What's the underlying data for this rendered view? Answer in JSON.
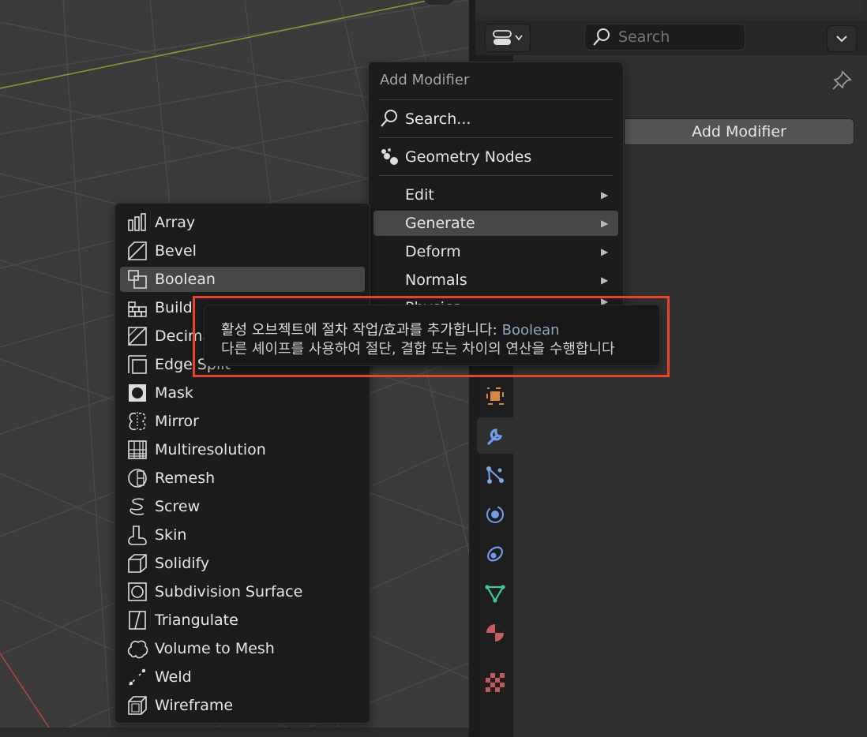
{
  "header": {
    "search_placeholder": "Search"
  },
  "properties": {
    "add_modifier_button": "Add Modifier"
  },
  "add_menu": {
    "title": "Add Modifier",
    "search": "Search...",
    "geometry_nodes": "Geometry Nodes",
    "categories": [
      "Edit",
      "Generate",
      "Deform",
      "Normals",
      "Physics"
    ],
    "highlighted": "Generate"
  },
  "generate_menu": {
    "items": [
      "Array",
      "Bevel",
      "Boolean",
      "Build",
      "Decimate",
      "Edge Split",
      "Mask",
      "Mirror",
      "Multiresolution",
      "Remesh",
      "Screw",
      "Skin",
      "Solidify",
      "Subdivision Surface",
      "Triangulate",
      "Volume to Mesh",
      "Weld",
      "Wireframe"
    ],
    "highlighted": "Boolean"
  },
  "tooltip": {
    "line1": "활성 오브젝트에 절차 작업/효과를 추가합니다:",
    "name": "Boolean",
    "line2": "다른 셰이프를 사용하여 절단, 결합 또는 차이의 연산을 수행합니다"
  },
  "colors": {
    "highlight_box": "#e8442a",
    "grid_line": "#4a4a4a",
    "x_axis": "#b04a4a",
    "y_axis": "#8aa83a"
  },
  "icons": {
    "tabs": [
      "object-icon",
      "modifier-wrench-icon",
      "particles-icon",
      "physics-icon",
      "constraints-icon",
      "object-data-icon",
      "material-icon",
      "texture-icon"
    ]
  }
}
